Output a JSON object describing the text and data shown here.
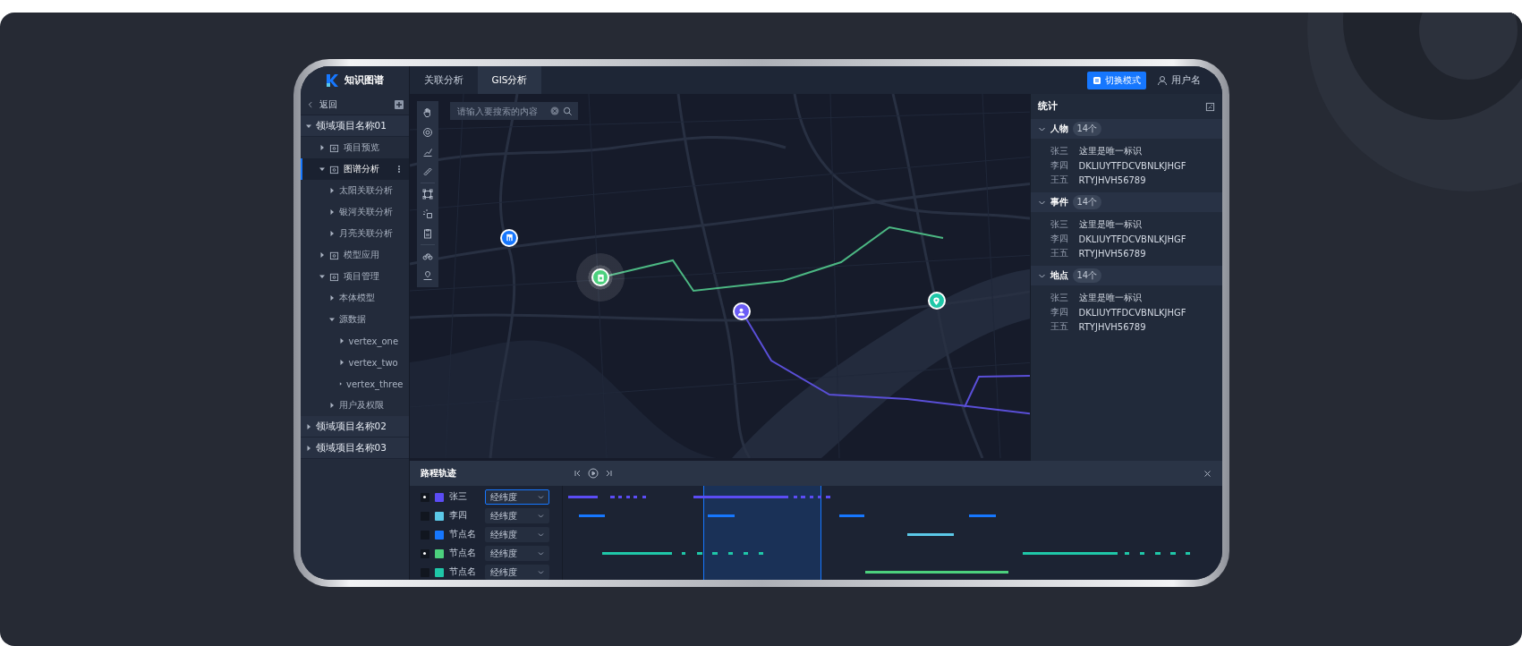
{
  "app": {
    "title": "知识图谱"
  },
  "tabs": [
    {
      "label": "关联分析",
      "selected": false
    },
    {
      "label": "GIS分析",
      "selected": true
    }
  ],
  "header": {
    "mode_button": "切换模式",
    "user": "用户名"
  },
  "sidebar": {
    "back_label": "返回",
    "groups": [
      {
        "label": "领域项目名称01",
        "expanded": true,
        "selected": false,
        "children": [
          {
            "label": "项目预览",
            "expanded": false,
            "selected": false
          },
          {
            "label": "图谱分析",
            "expanded": true,
            "selected": true,
            "children": [
              {
                "label": "太阳关联分析",
                "expanded": false,
                "selected": false
              },
              {
                "label": "银河关联分析",
                "expanded": false,
                "selected": false
              },
              {
                "label": "月亮关联分析",
                "expanded": false,
                "selected": false
              }
            ]
          },
          {
            "label": "模型应用",
            "expanded": false,
            "selected": false
          },
          {
            "label": "项目管理",
            "expanded": true,
            "selected": false,
            "children": [
              {
                "label": "本体模型",
                "expanded": false,
                "selected": false
              },
              {
                "label": "源数据",
                "expanded": true,
                "selected": false,
                "children": [
                  {
                    "label": "vertex_one",
                    "expanded": false,
                    "selected": false
                  },
                  {
                    "label": "vertex_two",
                    "expanded": false,
                    "selected": false
                  },
                  {
                    "label": "vertex_three",
                    "expanded": false,
                    "selected": false
                  }
                ]
              },
              {
                "label": "用户及权限",
                "expanded": false,
                "selected": false
              }
            ]
          }
        ]
      },
      {
        "label": "领域项目名称02",
        "expanded": false,
        "selected": false
      },
      {
        "label": "领域项目名称03",
        "expanded": false,
        "selected": false
      }
    ]
  },
  "map": {
    "search": {
      "placeholder": "请输入要搜索的内容"
    },
    "markers": [
      {
        "kind": "building",
        "color": "#1677ff"
      },
      {
        "kind": "badge",
        "color": "#4cd07d"
      },
      {
        "kind": "person",
        "color": "#6b5cf6"
      },
      {
        "kind": "pin",
        "color": "#1fc7a8"
      }
    ]
  },
  "stats": {
    "title": "统计",
    "sections": [
      {
        "title": "人物",
        "count": "14个",
        "expanded": true,
        "rows": [
          {
            "key": "张三",
            "value": "这里是唯一标识"
          },
          {
            "key": "李四",
            "value": "DKLIUYTFDCVBNLKJHGF"
          },
          {
            "key": "王五",
            "value": "RTYJHVH56789"
          }
        ]
      },
      {
        "title": "事件",
        "count": "14个",
        "expanded": true,
        "rows": [
          {
            "key": "张三",
            "value": "这里是唯一标识"
          },
          {
            "key": "李四",
            "value": "DKLIUYTFDCVBNLKJHGF"
          },
          {
            "key": "王五",
            "value": "RTYJHVH56789"
          }
        ]
      },
      {
        "title": "地点",
        "count": "14个",
        "expanded": true,
        "rows": [
          {
            "key": "张三",
            "value": "这里是唯一标识"
          },
          {
            "key": "李四",
            "value": "DKLIUYTFDCVBNLKJHGF"
          },
          {
            "key": "王五",
            "value": "RTYJHVH56789"
          }
        ]
      }
    ]
  },
  "timeline": {
    "title": "路程轨迹",
    "rows": [
      {
        "name": "张三",
        "color": "#5b4cf5",
        "checked": true,
        "field": "经纬度",
        "focused": true
      },
      {
        "name": "李四",
        "color": "#5bc8e8",
        "checked": false,
        "field": "经纬度",
        "focused": false
      },
      {
        "name": "节点名",
        "color": "#1677ff",
        "checked": false,
        "field": "经纬度",
        "focused": false
      },
      {
        "name": "节点名",
        "color": "#4cd07d",
        "checked": true,
        "field": "经纬度",
        "focused": false
      },
      {
        "name": "节点名",
        "color": "#1fc7a8",
        "checked": false,
        "field": "经纬度",
        "focused": false
      }
    ]
  }
}
